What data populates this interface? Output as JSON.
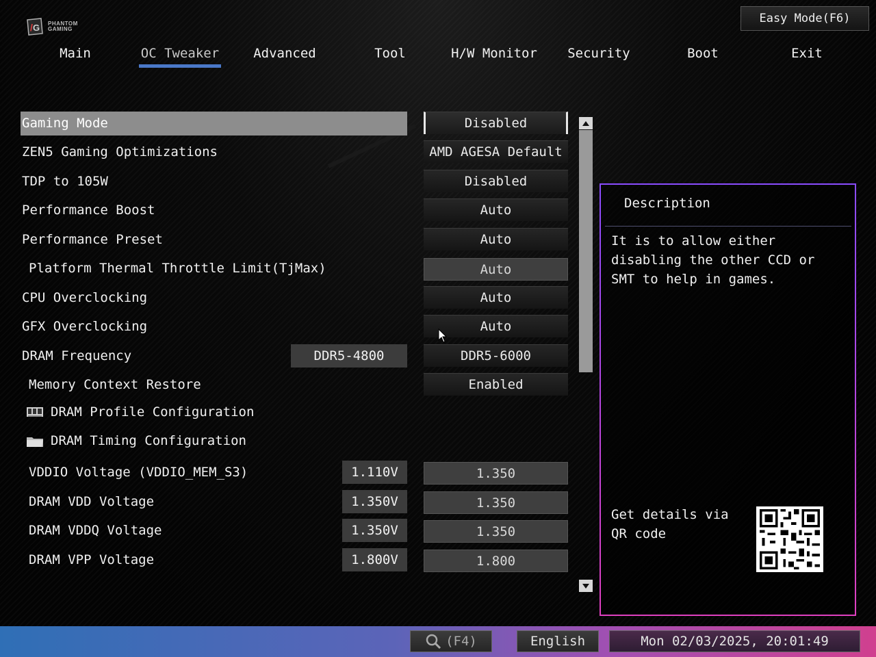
{
  "header": {
    "logo_text_line1": "PHANTOM",
    "logo_text_line2": "GAMING",
    "easy_mode_label": "Easy Mode(F6)"
  },
  "tabs": [
    {
      "label": "Main"
    },
    {
      "label": "OC Tweaker"
    },
    {
      "label": "Advanced"
    },
    {
      "label": "Tool"
    },
    {
      "label": "H/W Monitor"
    },
    {
      "label": "Security"
    },
    {
      "label": "Boot"
    },
    {
      "label": "Exit"
    }
  ],
  "active_tab": "OC Tweaker",
  "settings": [
    {
      "label": "Gaming Mode",
      "value": "Disabled"
    },
    {
      "label": "ZEN5 Gaming Optimizations",
      "value": "AMD AGESA Default"
    },
    {
      "label": "TDP to 105W",
      "value": "Disabled"
    },
    {
      "label": "Performance Boost",
      "value": "Auto"
    },
    {
      "label": "Performance Preset",
      "value": "Auto"
    },
    {
      "label": "Platform Thermal Throttle Limit(TjMax)",
      "value": "Auto"
    },
    {
      "label": "CPU Overclocking",
      "value": "Auto"
    },
    {
      "label": "GFX Overclocking",
      "value": "Auto"
    },
    {
      "label": "DRAM Frequency",
      "current": "DDR5-4800",
      "value": "DDR5-6000"
    },
    {
      "label": "Memory Context Restore",
      "value": "Enabled"
    },
    {
      "label": "DRAM Profile Configuration"
    },
    {
      "label": "DRAM Timing Configuration"
    },
    {
      "label": "VDDIO Voltage (VDDIO_MEM_S3)",
      "current": "1.110V",
      "value": "1.350"
    },
    {
      "label": "DRAM VDD Voltage",
      "current": "1.350V",
      "value": "1.350"
    },
    {
      "label": "DRAM VDDQ Voltage",
      "current": "1.350V",
      "value": "1.350"
    },
    {
      "label": "DRAM VPP Voltage",
      "current": "1.800V",
      "value": "1.800"
    }
  ],
  "description": {
    "title": "Description",
    "text": "It is to allow either disabling the other CCD or SMT to help in games.",
    "qr_text": "Get details via QR code"
  },
  "footer": {
    "search_label": "(F4)",
    "language": "English",
    "datetime": "Mon 02/03/2025, 20:01:49"
  },
  "colors": {
    "accent_underline": "#4a78c8",
    "panel_border_start": "#8a4cff",
    "panel_border_end": "#e040c0",
    "footer_start": "#2f6fb6",
    "footer_end": "#d0408f"
  }
}
